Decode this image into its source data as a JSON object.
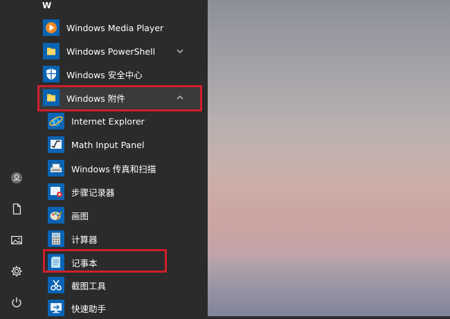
{
  "start_menu": {
    "section_letter": "W",
    "apps": [
      {
        "label": "Windows Media Player",
        "icon": "media-player-icon"
      },
      {
        "label": "Windows PowerShell",
        "icon": "folder-icon",
        "expandable": true,
        "expanded": false
      },
      {
        "label": "Windows 安全中心",
        "icon": "shield-icon"
      },
      {
        "label": "Windows 附件",
        "icon": "folder-icon",
        "expandable": true,
        "expanded": true,
        "highlighted": true
      },
      {
        "label": "Internet Explorer",
        "icon": "internet-explorer-icon",
        "indent": true
      },
      {
        "label": "Math Input Panel",
        "icon": "math-input-panel-icon",
        "indent": true
      },
      {
        "label": "Windows 传真和扫描",
        "icon": "fax-scan-icon",
        "indent": true
      },
      {
        "label": "步骤记录器",
        "icon": "steps-recorder-icon",
        "indent": true
      },
      {
        "label": "画图",
        "icon": "paint-icon",
        "indent": true
      },
      {
        "label": "计算器",
        "icon": "calculator-icon",
        "indent": true
      },
      {
        "label": "记事本",
        "icon": "notepad-icon",
        "indent": true,
        "highlighted": true
      },
      {
        "label": "截图工具",
        "icon": "snipping-tool-icon",
        "indent": true
      },
      {
        "label": "快速助手",
        "icon": "quick-assist-icon",
        "indent": true
      }
    ]
  },
  "rail": {
    "items": [
      "user-icon",
      "documents-icon",
      "pictures-icon",
      "settings-icon",
      "power-icon"
    ]
  },
  "colors": {
    "menu_bg": "#2b2b2b",
    "tile_blue": "#0a64b4",
    "highlight_red": "#d11f2a",
    "text": "#ffffff"
  }
}
